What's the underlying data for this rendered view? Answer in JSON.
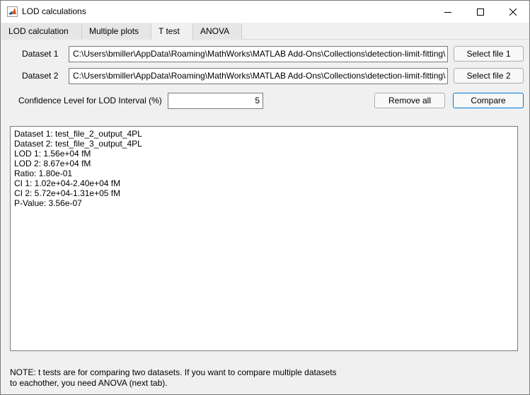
{
  "window": {
    "title": "LOD calculations",
    "app_icon": "matlab-icon"
  },
  "tabs": [
    {
      "label": "LOD calculation",
      "active": false
    },
    {
      "label": "Multiple plots",
      "active": false
    },
    {
      "label": "T test",
      "active": true
    },
    {
      "label": "ANOVA",
      "active": false
    }
  ],
  "form": {
    "dataset1_label": "Dataset 1",
    "dataset1_path": "C:\\Users\\bmiller\\AppData\\Roaming\\MathWorks\\MATLAB Add-Ons\\Collections\\detection-limit-fitting\\",
    "select_file1_label": "Select file 1",
    "dataset2_label": "Dataset 2",
    "dataset2_path": "C:\\Users\\bmiller\\AppData\\Roaming\\MathWorks\\MATLAB Add-Ons\\Collections\\detection-limit-fitting\\",
    "select_file2_label": "Select file 2",
    "confidence_label": "Confidence Level for LOD Interval (%)",
    "confidence_value": "5",
    "remove_all_label": "Remove all",
    "compare_label": "Compare"
  },
  "output_lines": [
    "Dataset 1: test_file_2_output_4PL",
    "Dataset 2: test_file_3_output_4PL",
    "LOD 1: 1.56e+04 fM",
    "LOD 2: 8.67e+04 fM",
    "Ratio: 1.80e-01",
    "CI 1: 1.02e+04-2.40e+04 fM",
    "CI 2: 5.72e+04-1.31e+05 fM",
    "P-Value: 3.56e-07"
  ],
  "note": {
    "line1": "NOTE: t tests are for comparing two datasets. If you want to compare multiple datasets",
    "line2": "to eachother, you need ANOVA (next tab)."
  }
}
